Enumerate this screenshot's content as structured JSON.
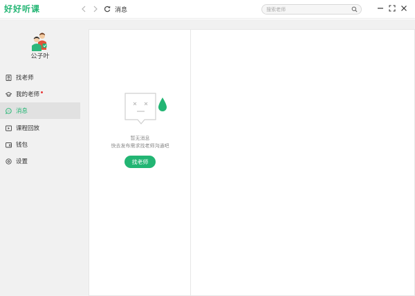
{
  "app": {
    "logo_text": "好好听课",
    "page_title": "消息"
  },
  "search": {
    "placeholder": "搜索老师"
  },
  "user": {
    "name": "公子叶"
  },
  "sidebar": {
    "items": [
      {
        "label": "找老师",
        "icon": "find-teacher-icon"
      },
      {
        "label": "我的老师",
        "icon": "my-teacher-icon",
        "has_notification": true
      },
      {
        "label": "消息",
        "icon": "message-icon",
        "active": true
      },
      {
        "label": "课程回放",
        "icon": "playback-icon"
      },
      {
        "label": "钱包",
        "icon": "wallet-icon"
      },
      {
        "label": "设置",
        "icon": "settings-icon"
      }
    ]
  },
  "empty_state": {
    "title": "暂无消息",
    "subtitle": "快去发布需求找老师沟通吧",
    "button_label": "找老师"
  },
  "colors": {
    "accent": "#22b573",
    "notification": "#e73a3a",
    "sidebar_bg": "#f1f1f1",
    "active_bg": "#e1e1e1"
  }
}
